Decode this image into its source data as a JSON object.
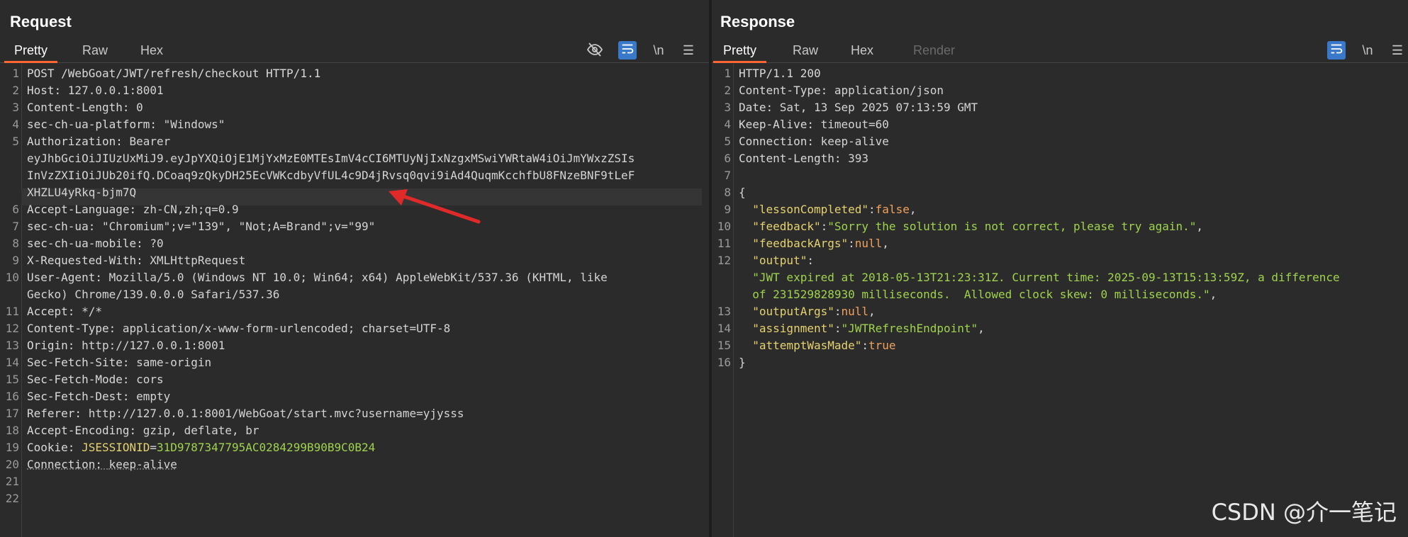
{
  "request": {
    "title": "Request",
    "tabs": [
      "Pretty",
      "Raw",
      "Hex"
    ],
    "tools": {
      "hide_icon": "eye-slash-icon",
      "wrap_icon": "wrap-icon",
      "newline": "\\n",
      "menu_icon": "hamburger-icon"
    },
    "line_numbers": [
      "1",
      "2",
      "3",
      "4",
      "5",
      "6",
      "7",
      "8",
      "9",
      "10",
      "11",
      "12",
      "13",
      "14",
      "15",
      "16",
      "17",
      "18",
      "19",
      "20",
      "21",
      "22"
    ],
    "lines": [
      {
        "k": "POST /WebGoat/JWT/refresh/checkout HTTP/1.1",
        "v": ""
      },
      {
        "k": "Host",
        "v": "127.0.0.1:8001"
      },
      {
        "k": "Content-Length",
        "v": "0"
      },
      {
        "k": "sec-ch-ua-platform",
        "v": "\"Windows\""
      },
      {
        "k": "Authorization",
        "v": "Bearer"
      },
      {
        "k": "",
        "v": "eyJhbGciOiJIUzUxMiJ9.eyJpYXQiOjE1MjYxMzE0MTEsImV4cCI6MTUyNjIxNzgxMSwiYWRtaW4iOiJmYWxzZSIs"
      },
      {
        "k": "",
        "v": "InVzZXIiOiJUb20ifQ.DCoaq9zQkyDH25EcVWKcdbyVfUL4c9D4jRvsq0qvi9iAd4QuqmKcchfbU8FNzeBNF9tLeF"
      },
      {
        "k": "",
        "v": "XHZLU4yRkq-bjm7Q"
      },
      {
        "k": "Accept-Language",
        "v": "zh-CN,zh;q=0.9"
      },
      {
        "k": "sec-ch-ua",
        "v": "\"Chromium\";v=\"139\", \"Not;A=Brand\";v=\"99\""
      },
      {
        "k": "sec-ch-ua-mobile",
        "v": "?0"
      },
      {
        "k": "X-Requested-With",
        "v": "XMLHttpRequest"
      },
      {
        "k": "User-Agent",
        "v": "Mozilla/5.0 (Windows NT 10.0; Win64; x64) AppleWebKit/537.36 (KHTML, like"
      },
      {
        "k": "",
        "v": "Gecko) Chrome/139.0.0.0 Safari/537.36"
      },
      {
        "k": "Accept",
        "v": "*/*"
      },
      {
        "k": "Content-Type",
        "v": "application/x-www-form-urlencoded; charset=UTF-8"
      },
      {
        "k": "Origin",
        "v": "http://127.0.0.1:8001"
      },
      {
        "k": "Sec-Fetch-Site",
        "v": "same-origin"
      },
      {
        "k": "Sec-Fetch-Mode",
        "v": "cors"
      },
      {
        "k": "Sec-Fetch-Dest",
        "v": "empty"
      },
      {
        "k": "Referer",
        "v": "http://127.0.0.1:8001/WebGoat/start.mvc?username=yjysss"
      },
      {
        "k": "Accept-Encoding",
        "v": "gzip, deflate, br"
      },
      {
        "k": "Cookie",
        "v": "",
        "ck": "JSESSIONID",
        "cv": "31D9787347795AC0284299B90B9C0B24"
      },
      {
        "k": "Connection",
        "v": "keep-alive"
      }
    ]
  },
  "response": {
    "title": "Response",
    "tabs": [
      "Pretty",
      "Raw",
      "Hex",
      "Render"
    ],
    "tools": {
      "wrap_icon": "wrap-icon",
      "newline": "\\n",
      "menu_icon": "hamburger-icon"
    },
    "line_numbers": [
      "1",
      "2",
      "3",
      "4",
      "5",
      "6",
      "7",
      "8",
      "9",
      "10",
      "11",
      "12",
      "13",
      "14",
      "15",
      "16"
    ],
    "headers": [
      {
        "k": "HTTP/1.1 200",
        "v": ""
      },
      {
        "k": "Content-Type",
        "v": "application/json"
      },
      {
        "k": "Date",
        "v": "Sat, 13 Sep 2025 07:13:59 GMT"
      },
      {
        "k": "Keep-Alive",
        "v": "timeout=60"
      },
      {
        "k": "Connection",
        "v": "keep-alive"
      },
      {
        "k": "Content-Length",
        "v": "393"
      }
    ],
    "body": {
      "open": "{",
      "close": "}",
      "lessonCompleted": "false",
      "feedback": "\"Sorry the solution is not correct, please try again.\"",
      "feedbackArgs": "null",
      "output_line1": "\"JWT expired at 2018-05-13T21:23:31Z. Current time: 2025-09-13T15:13:59Z, a difference",
      "output_line2": "of 231529828930 milliseconds.  Allowed clock skew: 0 milliseconds.\"",
      "outputArgs": "null",
      "assignment": "\"JWTRefreshEndpoint\"",
      "attemptWasMade": "true"
    }
  },
  "watermark": "CSDN @介一笔记"
}
